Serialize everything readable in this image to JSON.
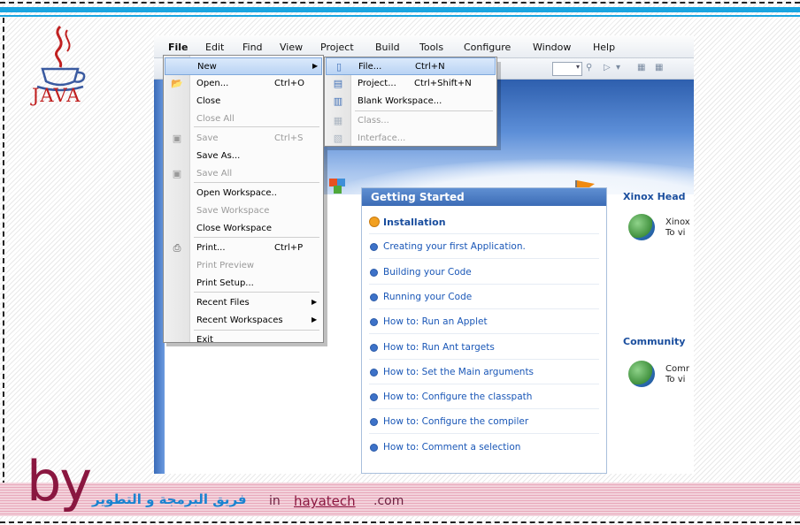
{
  "logo": {
    "text": "JAVA"
  },
  "menubar": [
    "File",
    "Edit",
    "Find",
    "View",
    "Project",
    "Build",
    "Tools",
    "Configure",
    "Window",
    "Help"
  ],
  "file_menu": [
    {
      "label": "New",
      "shortcut": "",
      "submenu": true,
      "highlighted": true,
      "disabled": false,
      "icon": ""
    },
    {
      "label": "Open...",
      "shortcut": "Ctrl+O",
      "submenu": false,
      "highlighted": false,
      "disabled": false,
      "icon": "folder-icon"
    },
    {
      "label": "Close",
      "shortcut": "",
      "submenu": false,
      "highlighted": false,
      "disabled": false,
      "icon": ""
    },
    {
      "label": "Close All",
      "shortcut": "",
      "submenu": false,
      "highlighted": false,
      "disabled": true,
      "icon": ""
    },
    {
      "label": "Save",
      "shortcut": "Ctrl+S",
      "submenu": false,
      "highlighted": false,
      "disabled": true,
      "icon": "save-icon"
    },
    {
      "label": "Save As...",
      "shortcut": "",
      "submenu": false,
      "highlighted": false,
      "disabled": false,
      "icon": ""
    },
    {
      "label": "Save All",
      "shortcut": "",
      "submenu": false,
      "highlighted": false,
      "disabled": true,
      "icon": "save-all-icon"
    },
    {
      "label": "Open Workspace..",
      "shortcut": "",
      "submenu": false,
      "highlighted": false,
      "disabled": false,
      "icon": ""
    },
    {
      "label": "Save Workspace",
      "shortcut": "",
      "submenu": false,
      "highlighted": false,
      "disabled": true,
      "icon": ""
    },
    {
      "label": "Close Workspace",
      "shortcut": "",
      "submenu": false,
      "highlighted": false,
      "disabled": false,
      "icon": ""
    },
    {
      "label": "Print...",
      "shortcut": "Ctrl+P",
      "submenu": false,
      "highlighted": false,
      "disabled": false,
      "icon": "printer-icon"
    },
    {
      "label": "Print Preview",
      "shortcut": "",
      "submenu": false,
      "highlighted": false,
      "disabled": true,
      "icon": ""
    },
    {
      "label": "Print Setup...",
      "shortcut": "",
      "submenu": false,
      "highlighted": false,
      "disabled": false,
      "icon": ""
    },
    {
      "label": "Recent Files",
      "shortcut": "",
      "submenu": true,
      "highlighted": false,
      "disabled": false,
      "icon": ""
    },
    {
      "label": "Recent Workspaces",
      "shortcut": "",
      "submenu": true,
      "highlighted": false,
      "disabled": false,
      "icon": ""
    },
    {
      "label": "Exit",
      "shortcut": "",
      "submenu": false,
      "highlighted": false,
      "disabled": false,
      "icon": ""
    }
  ],
  "new_submenu": [
    {
      "label": "File...",
      "shortcut": "Ctrl+N",
      "highlighted": true,
      "disabled": false,
      "icon": "file-icon"
    },
    {
      "label": "Project...",
      "shortcut": "Ctrl+Shift+N",
      "highlighted": false,
      "disabled": false,
      "icon": "project-icon"
    },
    {
      "label": "Blank Workspace...",
      "shortcut": "",
      "highlighted": false,
      "disabled": false,
      "icon": "workspace-icon"
    },
    {
      "label": "Class...",
      "shortcut": "",
      "highlighted": false,
      "disabled": true,
      "icon": "class-icon"
    },
    {
      "label": "Interface...",
      "shortcut": "",
      "highlighted": false,
      "disabled": true,
      "icon": "interface-icon"
    }
  ],
  "getting_started": {
    "title": "Getting Started",
    "links": [
      "Installation",
      "Creating your first Application.",
      "Building your Code",
      "Running your Code",
      "How to: Run an Applet",
      "How to: Run Ant targets",
      "How to: Set the Main arguments",
      "How to: Configure the classpath",
      "How to: Configure the compiler",
      "How to: Comment a selection"
    ]
  },
  "right_panel": {
    "headlines_title": "Xinox Head",
    "headlines_text": [
      "Xinox",
      "To vi"
    ],
    "community_title": "Community",
    "community_text": [
      "Comr",
      "To vi"
    ]
  },
  "footer": {
    "by": "by",
    "arabic": "فريق البرمجة و التطوير",
    "in": "in",
    "site": "hayatech",
    "tld": ".com"
  },
  "colors": {
    "accent_blue": "#1aa5e0",
    "menu_highlight": "#b9d3f4",
    "footer_maroon": "#8a1740",
    "link_blue": "#1a57b7"
  }
}
